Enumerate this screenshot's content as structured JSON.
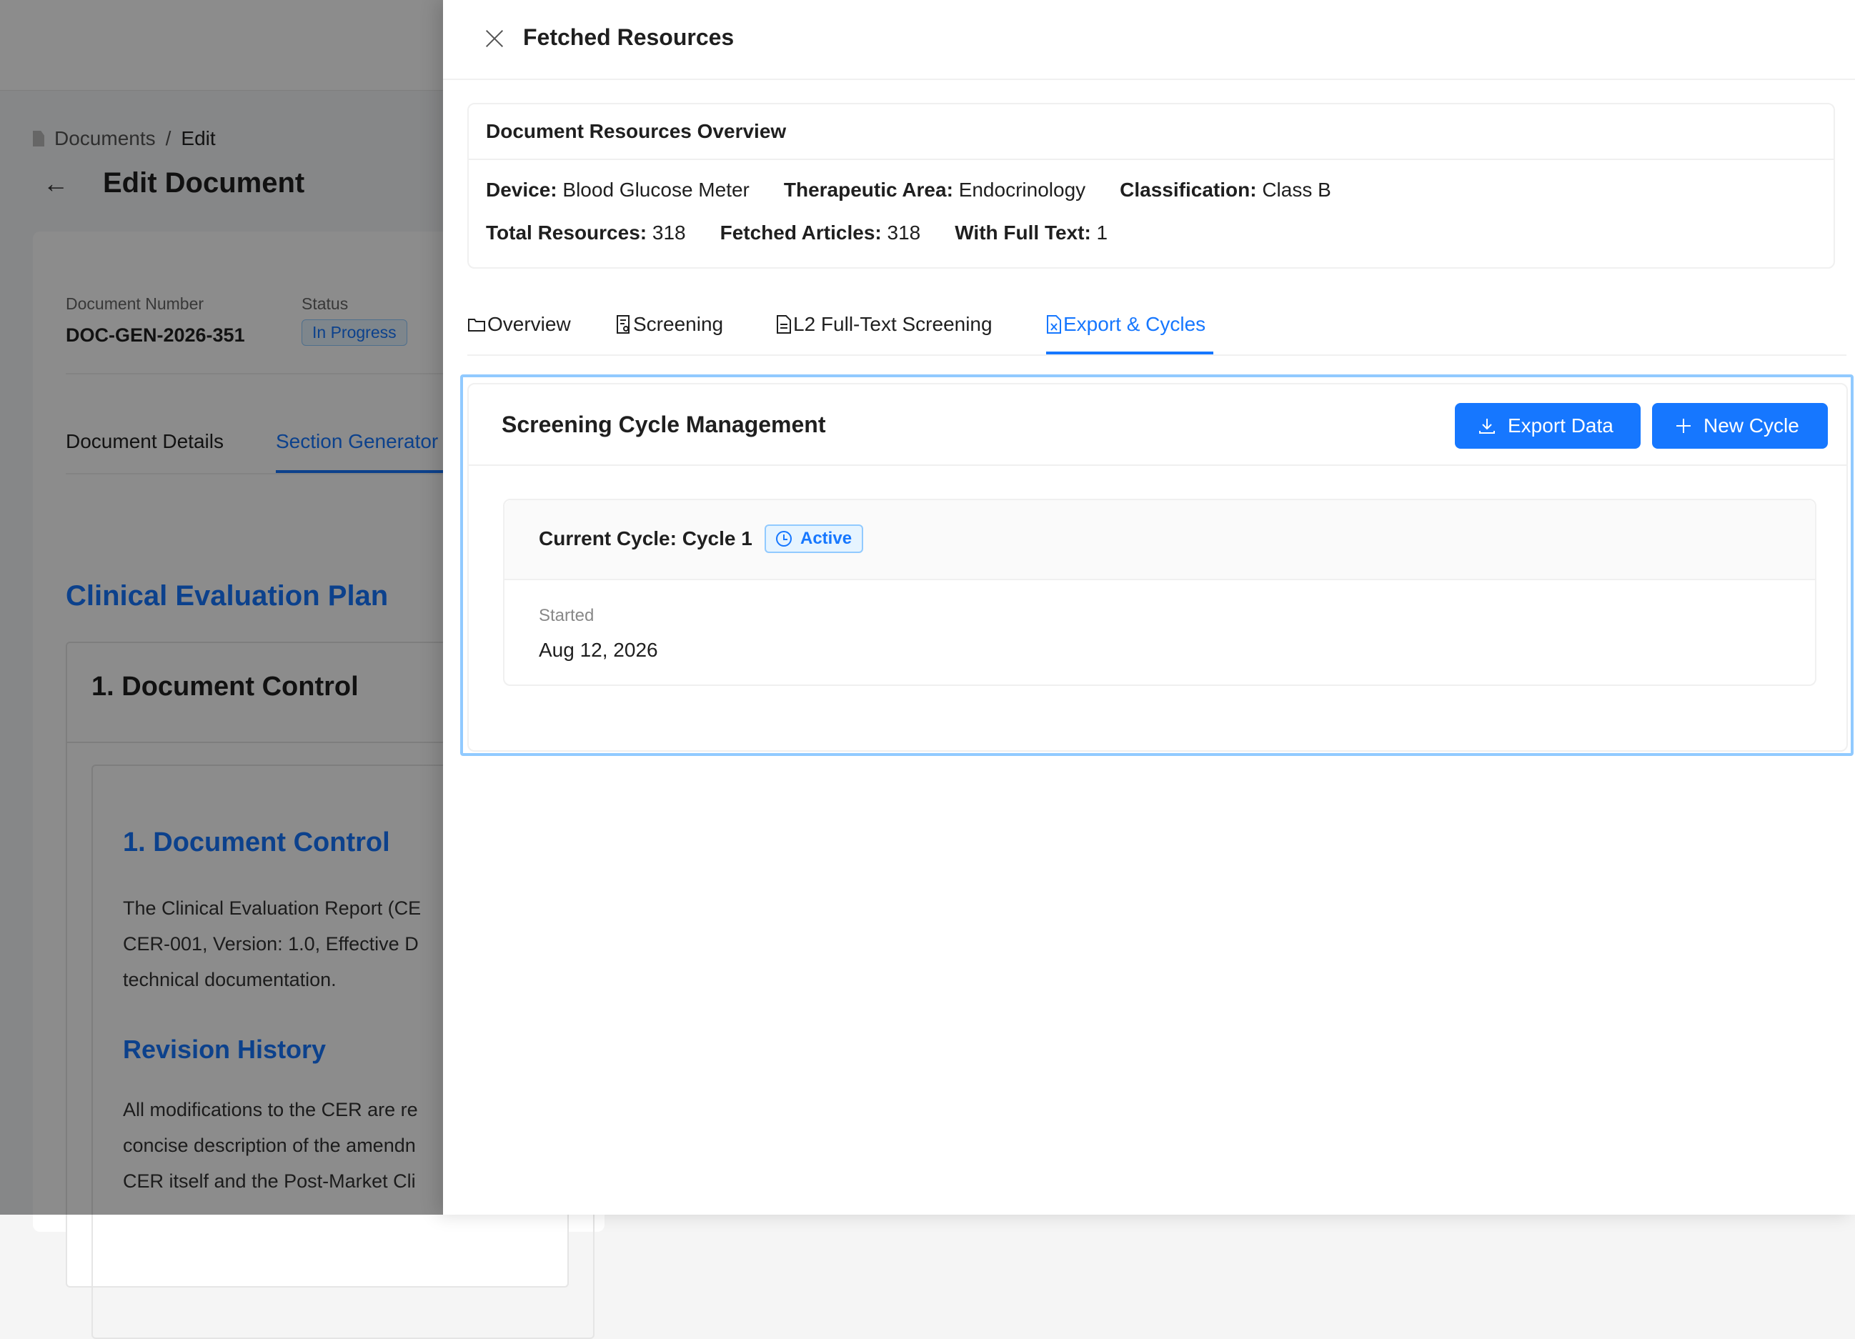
{
  "background": {
    "breadcrumb": {
      "root": "Documents",
      "sep": "/",
      "current": "Edit"
    },
    "page_title": "Edit Document",
    "doc_number_label": "Document Number",
    "doc_number": "DOC-GEN-2026-351",
    "status_label": "Status",
    "status": "In Progress",
    "tabs": [
      "Document Details",
      "Section Generator"
    ],
    "section_title": "Clinical Evaluation Plan",
    "control_title": "1. Document Control",
    "inner_heading": "1. Document Control",
    "para1": [
      "The Clinical Evaluation Report (CE",
      "CER-001, Version: 1.0, Effective D",
      "technical documentation."
    ],
    "revision_heading": "Revision History",
    "para2": [
      "All modifications to the CER are re",
      "concise description of the amendn",
      "CER itself and the Post-Market Cli"
    ]
  },
  "drawer": {
    "title": "Fetched Resources",
    "overview": {
      "title": "Document Resources Overview",
      "device_label": "Device:",
      "device": "Blood Glucose Meter",
      "area_label": "Therapeutic Area:",
      "area": "Endocrinology",
      "class_label": "Classification:",
      "class": "Class B",
      "total_label": "Total Resources:",
      "total": "318",
      "fetched_label": "Fetched Articles:",
      "fetched": "318",
      "fulltext_label": "With Full Text:",
      "fulltext": "1"
    },
    "tabs": [
      {
        "label": "Overview",
        "icon": "folder-icon"
      },
      {
        "label": "Screening",
        "icon": "screening-icon"
      },
      {
        "label": "L2 Full-Text Screening",
        "icon": "file-text-icon"
      },
      {
        "label": "Export & Cycles",
        "icon": "file-excel-icon",
        "active": true
      }
    ],
    "cycle": {
      "title": "Screening Cycle Management",
      "export_label": "Export Data",
      "new_label": "New Cycle",
      "current_label": "Current Cycle: Cycle 1",
      "status": "Active",
      "started_label": "Started",
      "started": "Aug 12, 2026"
    }
  }
}
